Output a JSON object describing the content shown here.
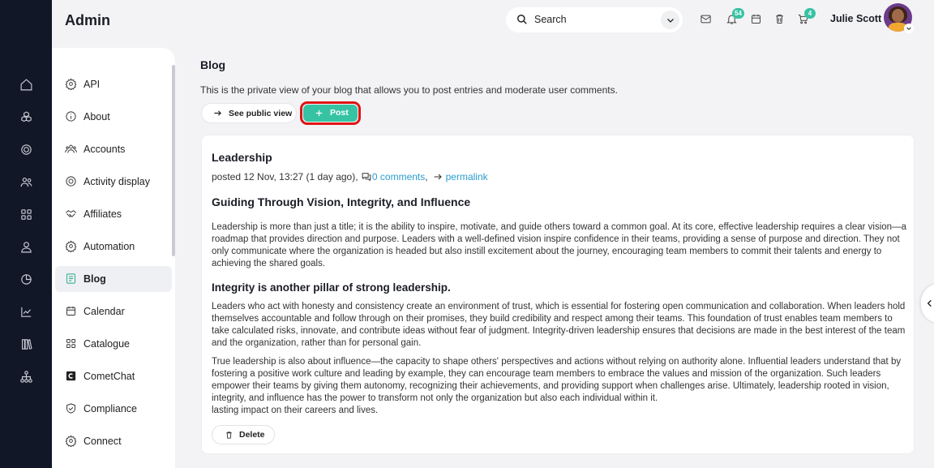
{
  "header": {
    "title": "Admin",
    "search_placeholder": "Search",
    "bell_badge": "54",
    "cart_badge": "4",
    "user_name": "Julie Scott"
  },
  "rail_icons": [
    "home-icon",
    "cube-icon",
    "target-icon",
    "users-icon",
    "apps-icon",
    "user-icon",
    "pie-chart-icon",
    "line-chart-icon",
    "library-icon",
    "hierarchy-icon"
  ],
  "sidebar": {
    "items": [
      {
        "label": "API",
        "icon": "gear-icon"
      },
      {
        "label": "About",
        "icon": "info-icon"
      },
      {
        "label": "Accounts",
        "icon": "users-icon"
      },
      {
        "label": "Activity display",
        "icon": "target-icon"
      },
      {
        "label": "Affiliates",
        "icon": "handshake-icon"
      },
      {
        "label": "Automation",
        "icon": "gear-icon"
      },
      {
        "label": "Blog",
        "icon": "document-icon",
        "active": true
      },
      {
        "label": "Calendar",
        "icon": "calendar-icon"
      },
      {
        "label": "Catalogue",
        "icon": "grid-icon"
      },
      {
        "label": "CometChat",
        "icon": "cometchat-icon"
      },
      {
        "label": "Compliance",
        "icon": "shield-check-icon"
      },
      {
        "label": "Connect",
        "icon": "gear-icon"
      }
    ]
  },
  "main": {
    "title": "Blog",
    "description": "This is the private view of your blog that allows you to post entries and moderate user comments.",
    "see_public_label": "See public view",
    "post_label": "Post"
  },
  "post": {
    "title": "Leadership",
    "meta_prefix": "posted 12 Nov, 13:27 (1 day ago),",
    "comments_link": "0 comments",
    "permalink": "permalink",
    "heading": "Guiding Through Vision, Integrity, and Influence",
    "para1": "Leadership is more than just a title; it is the ability to inspire, motivate, and guide others toward a common goal. At its core, effective leadership requires a clear vision—a roadmap that provides direction and purpose. Leaders with a well-defined vision inspire confidence in their teams, providing a sense of purpose and direction. They not only communicate where the organization is headed but also instill excitement about the journey, encouraging team members to commit their talents and energy to achieving the shared goals.",
    "subheading": "Integrity is another pillar of strong leadership.",
    "para2": "Leaders who act with honesty and consistency create an environment of trust, which is essential for fostering open communication and collaboration. When leaders hold themselves accountable and follow through on their promises, they build credibility and respect among their teams. This foundation of trust enables team members to take calculated risks, innovate, and contribute ideas without fear of judgment. Integrity-driven leadership ensures that decisions are made in the best interest of the team and the organization, rather than for personal gain.",
    "para3": "True leadership is also about influence—the capacity to shape others' perspectives and actions without relying on authority alone. Influential leaders understand that by fostering a positive work culture and leading by example, they can encourage team members to embrace the values and mission of the organization. Such leaders empower their teams by giving them autonomy, recognizing their achievements, and providing support when challenges arise. Ultimately, leadership rooted in vision, integrity, and influence has the power to transform not only the organization but also each individual within it.",
    "para3_tail": "lasting impact on their careers and lives.",
    "delete_label": "Delete"
  },
  "colors": {
    "accent": "#36c3a3",
    "link": "#2a9dcc",
    "highlight_outline": "#e01414",
    "rail": "#111726"
  }
}
